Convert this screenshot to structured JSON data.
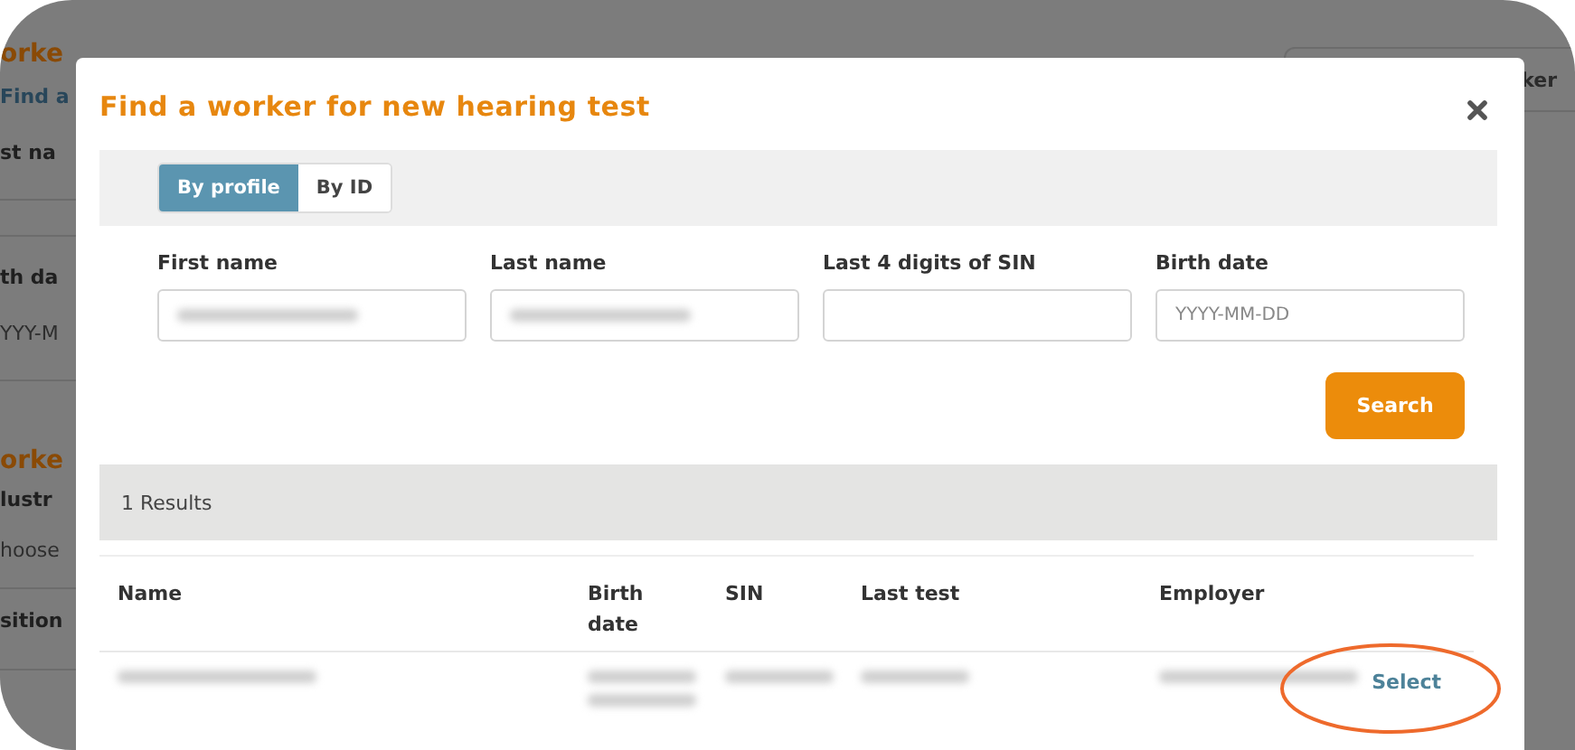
{
  "background_page": {
    "left_fragments": [
      {
        "text": "orke",
        "kind": "heading"
      },
      {
        "text": "Find a",
        "kind": "link"
      },
      {
        "text": "st na",
        "kind": "label"
      },
      {
        "text": "th da",
        "kind": "label"
      },
      {
        "text": "YYY-M",
        "kind": "field"
      },
      {
        "text": "orke",
        "kind": "heading"
      },
      {
        "text": "lustr",
        "kind": "label"
      },
      {
        "text": "hoose",
        "kind": "field"
      },
      {
        "text": "sition",
        "kind": "label"
      }
    ],
    "right_fragment": "ker"
  },
  "dialog": {
    "title": "Find a worker for new hearing test",
    "tabs": [
      {
        "label": "By profile",
        "selected": true
      },
      {
        "label": "By ID",
        "selected": false
      }
    ],
    "fields": [
      {
        "label": "First name",
        "kind": "blurred"
      },
      {
        "label": "Last name",
        "kind": "blurred"
      },
      {
        "label": "Last 4 digits of SIN",
        "kind": "empty"
      },
      {
        "label": "Birth date",
        "kind": "placeholder",
        "placeholder": "YYYY-MM-DD"
      }
    ],
    "search_button": "Search",
    "results_count": "1 Results",
    "table": {
      "columns": [
        "Name",
        "Birth date",
        "SIN",
        "Last test",
        "Employer"
      ],
      "rows": [
        {
          "cells": [
            {
              "kind": "blurred"
            },
            {
              "kind": "blurred_wrapped"
            },
            {
              "kind": "blurred"
            },
            {
              "kind": "blurred"
            },
            {
              "kind": "blurred"
            }
          ],
          "action": "Select",
          "highlighted": true
        }
      ]
    }
  }
}
